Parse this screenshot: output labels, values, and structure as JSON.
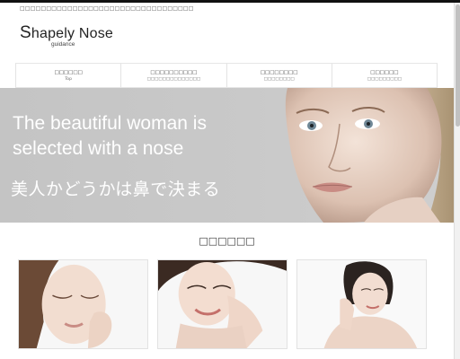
{
  "header": {
    "tagline": "□□□□□□□□□□□□□□□□□□□□□□□□□□□□□□□□□",
    "logo_first_letter": "S",
    "logo_rest": "hapely Nose",
    "logo_sub": "guidance"
  },
  "nav": {
    "items": [
      {
        "label": "□□□□□□",
        "sub": "Top"
      },
      {
        "label": "□□□□□□□□□□",
        "sub": "□□□□□□□□□□□□□□"
      },
      {
        "label": "□□□□□□□□",
        "sub": "□□□□□□□□"
      },
      {
        "label": "□□□□□□",
        "sub": "□□□□□□□□□"
      }
    ]
  },
  "hero": {
    "headline_line1": "The beautiful woman is",
    "headline_line2": "selected with a nose",
    "subheadline": "美人かどうかは鼻で決まる"
  },
  "section": {
    "title": "□□□□□□"
  },
  "cards": [
    {
      "icon": "woman-eyes-closed-photo"
    },
    {
      "icon": "woman-smiling-hands-photo"
    },
    {
      "icon": "woman-hand-cheek-photo"
    }
  ],
  "colors": {
    "topbar": "#111111",
    "hero_bg": "#c8c8c8",
    "hero_text": "#ffffff"
  }
}
